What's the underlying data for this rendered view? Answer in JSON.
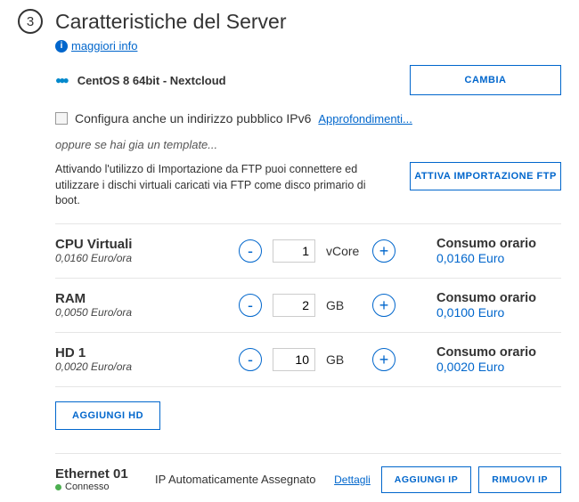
{
  "step": "3",
  "title": "Caratteristiche del Server",
  "more_info": "maggiori info",
  "os": {
    "name": "CentOS 8 64bit - Nextcloud",
    "change_btn": "CAMBIA"
  },
  "ipv6": {
    "label": "Configura anche un indirizzo pubblico IPv6",
    "link": "Approfondimenti..."
  },
  "template_hint": "oppure se hai gia un template...",
  "ftp": {
    "text": "Attivando l'utilizzo di Importazione da FTP puoi connettere ed utilizzare i dischi virtuali caricati via FTP come disco primario di boot.",
    "btn": "ATTIVA IMPORTAZIONE FTP"
  },
  "resources": {
    "cpu": {
      "label": "CPU Virtuali",
      "price": "0,0160 Euro/ora",
      "value": "1",
      "unit": "vCore",
      "cons_label": "Consumo orario",
      "cons_value": "0,0160 Euro"
    },
    "ram": {
      "label": "RAM",
      "price": "0,0050 Euro/ora",
      "value": "2",
      "unit": "GB",
      "cons_label": "Consumo orario",
      "cons_value": "0,0100 Euro"
    },
    "hd1": {
      "label": "HD 1",
      "price": "0,0020 Euro/ora",
      "value": "10",
      "unit": "GB",
      "cons_label": "Consumo orario",
      "cons_value": "0,0020 Euro"
    }
  },
  "add_hd": "AGGIUNGI HD",
  "ethernet": {
    "name": "Ethernet 01",
    "status": "Connesso",
    "ip_mode": "IP Automaticamente Assegnato",
    "details": "Dettagli",
    "add_ip": "AGGIUNGI IP",
    "remove_ip": "RIMUOVI IP"
  }
}
